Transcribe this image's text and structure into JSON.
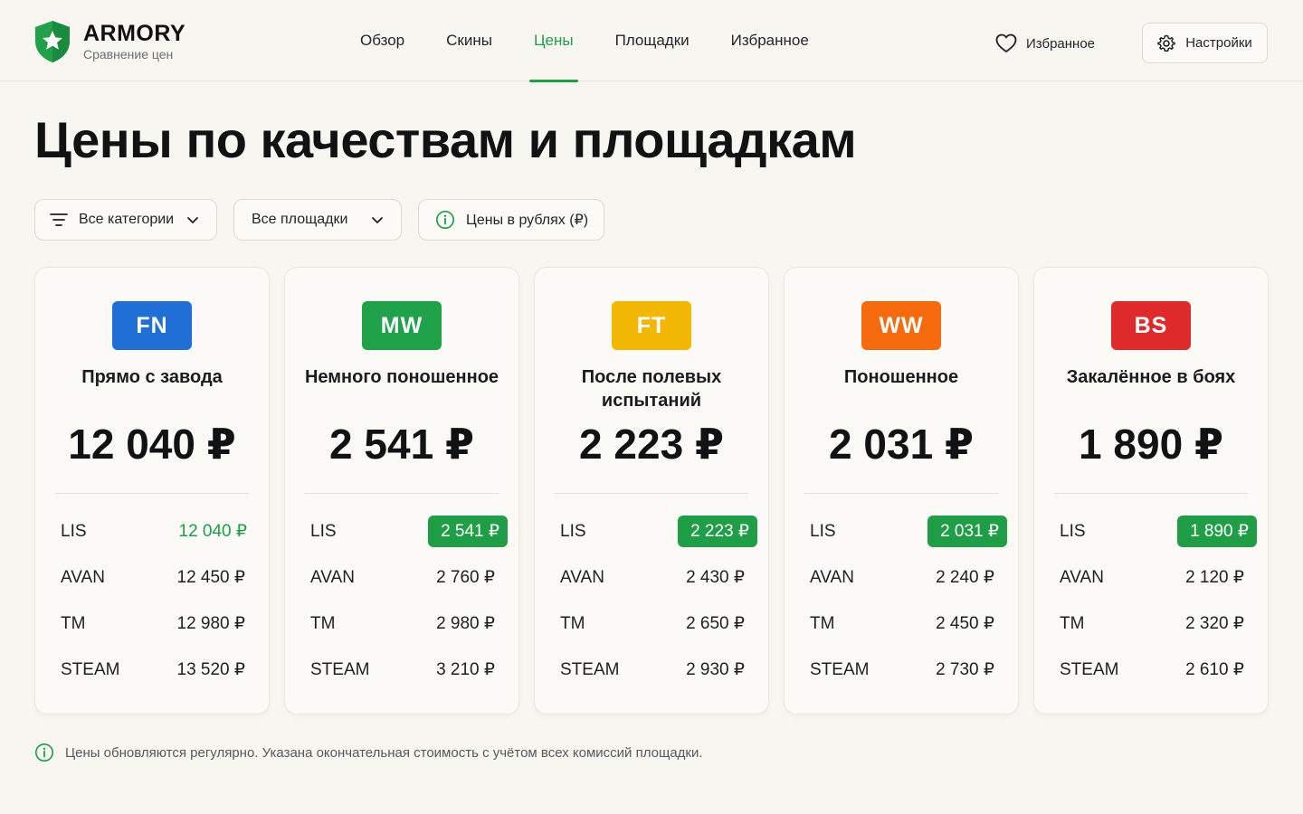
{
  "brand": {
    "name": "ARMORY",
    "tagline": "Сравнение цен",
    "color": "#22a04a"
  },
  "nav": {
    "items": [
      {
        "label": "Обзор",
        "active": false
      },
      {
        "label": "Скины",
        "active": false
      },
      {
        "label": "Цены",
        "active": true
      },
      {
        "label": "Площадки",
        "active": false
      },
      {
        "label": "Избранное",
        "active": false
      }
    ]
  },
  "header": {
    "favorites_label": "Избранное",
    "favorites_icon": "heart-icon",
    "settings_label": "Настройки",
    "settings_icon": "gear-icon"
  },
  "page": {
    "title": "Цены по качествам и площадкам"
  },
  "filters": {
    "categories": "Все категории",
    "platforms": "Все площадки",
    "currency": "Цены в рублях (₽)"
  },
  "colors": {
    "accent": "#1f9d47",
    "FN": "#1f6fd6",
    "MW": "#1fa24a",
    "FT": "#f2b705",
    "WW": "#f56a0c",
    "BS": "#de2a2a"
  },
  "cards": [
    {
      "code": "FN",
      "name": "Прямо с завода",
      "price": "12 040 ₽",
      "rows": [
        {
          "market": "LIS",
          "price": "12 040 ₽",
          "best": "text"
        },
        {
          "market": "AVAN",
          "price": "12 450 ₽",
          "best": ""
        },
        {
          "market": "TM",
          "price": "12 980 ₽",
          "best": ""
        },
        {
          "market": "STEAM",
          "price": "13 520 ₽",
          "best": ""
        }
      ]
    },
    {
      "code": "MW",
      "name": "Немного поношенное",
      "price": "2 541 ₽",
      "rows": [
        {
          "market": "LIS",
          "price": "2 541 ₽",
          "best": "pill"
        },
        {
          "market": "AVAN",
          "price": "2 760 ₽",
          "best": ""
        },
        {
          "market": "TM",
          "price": "2 980 ₽",
          "best": ""
        },
        {
          "market": "STEAM",
          "price": "3 210 ₽",
          "best": ""
        }
      ]
    },
    {
      "code": "FT",
      "name": "После полевых испытаний",
      "price": "2 223 ₽",
      "rows": [
        {
          "market": "LIS",
          "price": "2 223 ₽",
          "best": "pill"
        },
        {
          "market": "AVAN",
          "price": "2 430 ₽",
          "best": ""
        },
        {
          "market": "TM",
          "price": "2 650 ₽",
          "best": ""
        },
        {
          "market": "STEAM",
          "price": "2 930 ₽",
          "best": ""
        }
      ]
    },
    {
      "code": "WW",
      "name": "Поношенное",
      "price": "2 031 ₽",
      "rows": [
        {
          "market": "LIS",
          "price": "2 031 ₽",
          "best": "pill"
        },
        {
          "market": "AVAN",
          "price": "2 240 ₽",
          "best": ""
        },
        {
          "market": "TM",
          "price": "2 450 ₽",
          "best": ""
        },
        {
          "market": "STEAM",
          "price": "2 730 ₽",
          "best": ""
        }
      ]
    },
    {
      "code": "BS",
      "name": "Закалённое в боях",
      "price": "1 890 ₽",
      "rows": [
        {
          "market": "LIS",
          "price": "1 890 ₽",
          "best": "pill"
        },
        {
          "market": "AVAN",
          "price": "2 120 ₽",
          "best": ""
        },
        {
          "market": "TM",
          "price": "2 320 ₽",
          "best": ""
        },
        {
          "market": "STEAM",
          "price": "2 610 ₽",
          "best": ""
        }
      ]
    }
  ],
  "footer": {
    "note": "Цены обновляются регулярно. Указана окончательная стоимость с учётом всех комиссий площадки."
  }
}
